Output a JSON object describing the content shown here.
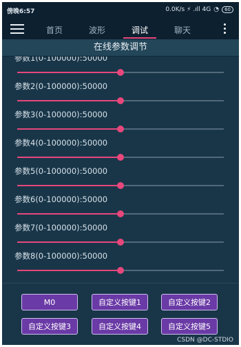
{
  "status_bar": {
    "time": "傍晚6:57",
    "right_text": "0.0K/s ⚡ .ıll 4G ",
    "battery": "60"
  },
  "nav": {
    "tabs": [
      "首页",
      "波形",
      "调试",
      "聊天"
    ],
    "active_tab": "调试"
  },
  "page_title": "在线参数调节",
  "params": [
    {
      "label": "参数1(0-100000):50000",
      "value": 50000,
      "max": 100000
    },
    {
      "label": "参数2(0-100000):50000",
      "value": 50000,
      "max": 100000
    },
    {
      "label": "参数3(0-100000):50000",
      "value": 50000,
      "max": 100000
    },
    {
      "label": "参数4(0-100000):50000",
      "value": 50000,
      "max": 100000
    },
    {
      "label": "参数5(0-100000):50000",
      "value": 50000,
      "max": 100000
    },
    {
      "label": "参数6(0-100000):50000",
      "value": 50000,
      "max": 100000
    },
    {
      "label": "参数7(0-100000):50000",
      "value": 50000,
      "max": 100000
    },
    {
      "label": "参数8(0-100000):50000",
      "value": 50000,
      "max": 100000
    }
  ],
  "buttons": [
    "M0",
    "自定义按键1",
    "自定义按键2",
    "自定义按键3",
    "自定义按键4",
    "自定义按键5"
  ],
  "watermark": "CSDN @DC-STDIO",
  "colors": {
    "accent": "#e8477c",
    "background": "#193649",
    "button": "#6a3aa6"
  }
}
